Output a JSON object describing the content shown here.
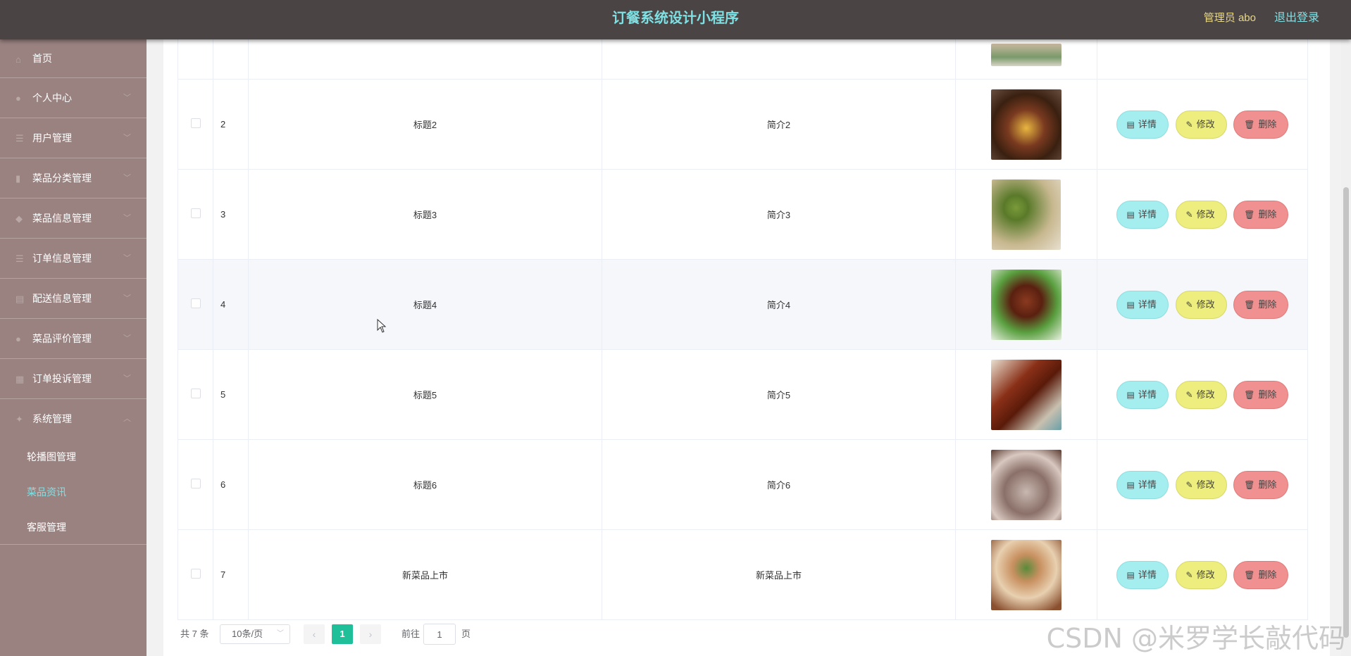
{
  "header": {
    "title": "订餐系统设计小程序",
    "admin": "管理员 abo",
    "logout": "退出登录"
  },
  "sidebar": {
    "items": [
      {
        "label": "首页",
        "icon": "home-icon"
      },
      {
        "label": "个人中心",
        "icon": "user-icon"
      },
      {
        "label": "用户管理",
        "icon": "list-icon"
      },
      {
        "label": "菜品分类管理",
        "icon": "chart-icon"
      },
      {
        "label": "菜品信息管理",
        "icon": "shield-icon"
      },
      {
        "label": "订单信息管理",
        "icon": "list-icon"
      },
      {
        "label": "配送信息管理",
        "icon": "document-icon"
      },
      {
        "label": "菜品评价管理",
        "icon": "user-icon"
      },
      {
        "label": "订单投诉管理",
        "icon": "grid-icon"
      },
      {
        "label": "系统管理",
        "icon": "settings-icon"
      }
    ],
    "subitems": [
      {
        "label": "轮播图管理"
      },
      {
        "label": "菜品资讯"
      },
      {
        "label": "客服管理"
      }
    ]
  },
  "table": {
    "rows": [
      {
        "num": "2",
        "title": "标题2",
        "brief": "简介2"
      },
      {
        "num": "3",
        "title": "标题3",
        "brief": "简介3"
      },
      {
        "num": "4",
        "title": "标题4",
        "brief": "简介4"
      },
      {
        "num": "5",
        "title": "标题5",
        "brief": "简介5"
      },
      {
        "num": "6",
        "title": "标题6",
        "brief": "简介6"
      },
      {
        "num": "7",
        "title": "新菜品上市",
        "brief": "新菜品上市"
      }
    ],
    "actions": {
      "detail": "详情",
      "edit": "修改",
      "delete": "删除"
    }
  },
  "pager": {
    "total": "共 7 条",
    "page_size": "10条/页",
    "current": "1",
    "goto_label": "前往",
    "goto_value": "1",
    "page_suffix": "页"
  },
  "watermark": "CSDN @米罗学长敲代码"
}
